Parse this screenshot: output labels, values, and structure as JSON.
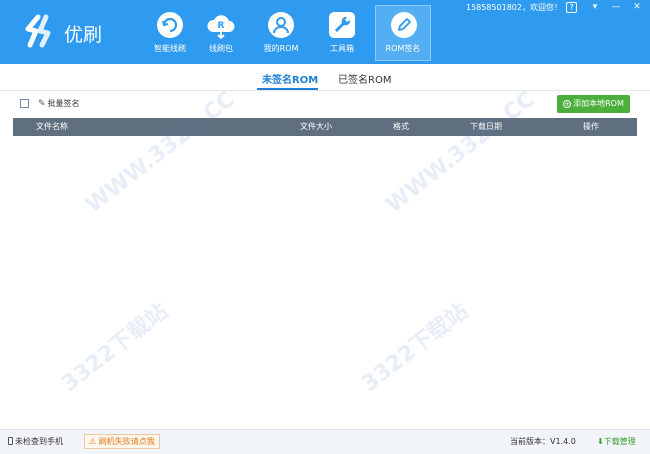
{
  "app": {
    "name": "优刷"
  },
  "user": {
    "greeting": "15858501802，欢迎您！"
  },
  "nav": [
    {
      "label": "智能线刷",
      "icon": "refresh-icon"
    },
    {
      "label": "线刷包",
      "icon": "cloud-download-icon",
      "badge": "R"
    },
    {
      "label": "我的ROM",
      "icon": "user-icon"
    },
    {
      "label": "工具箱",
      "icon": "wrench-icon"
    },
    {
      "label": "ROM签名",
      "icon": "pen-icon",
      "active": true
    }
  ],
  "window_controls": {
    "help": "?",
    "menu": "▾",
    "minimize": "—",
    "close": "✕"
  },
  "subtabs": [
    {
      "label": "未签名ROM",
      "active": true
    },
    {
      "label": "已签名ROM",
      "active": false
    }
  ],
  "toolbar": {
    "batch_label": "批量签名",
    "add_button": "添加本地ROM"
  },
  "table": {
    "columns": [
      "文件名称",
      "文件大小",
      "格式",
      "下载日期",
      "操作"
    ],
    "rows": []
  },
  "watermark": {
    "text1": "WWW.3322.CC",
    "text2": "3322下载站"
  },
  "status": {
    "phone": "未检查到手机",
    "warning": "刷机失败请点我",
    "version": "当前版本：V1.4.0",
    "download_manager": "下载管理"
  },
  "colors": {
    "header": "#2e9af0",
    "accent": "#1e7fd6",
    "green": "#4caf3c",
    "table_header": "#5f6f80"
  }
}
